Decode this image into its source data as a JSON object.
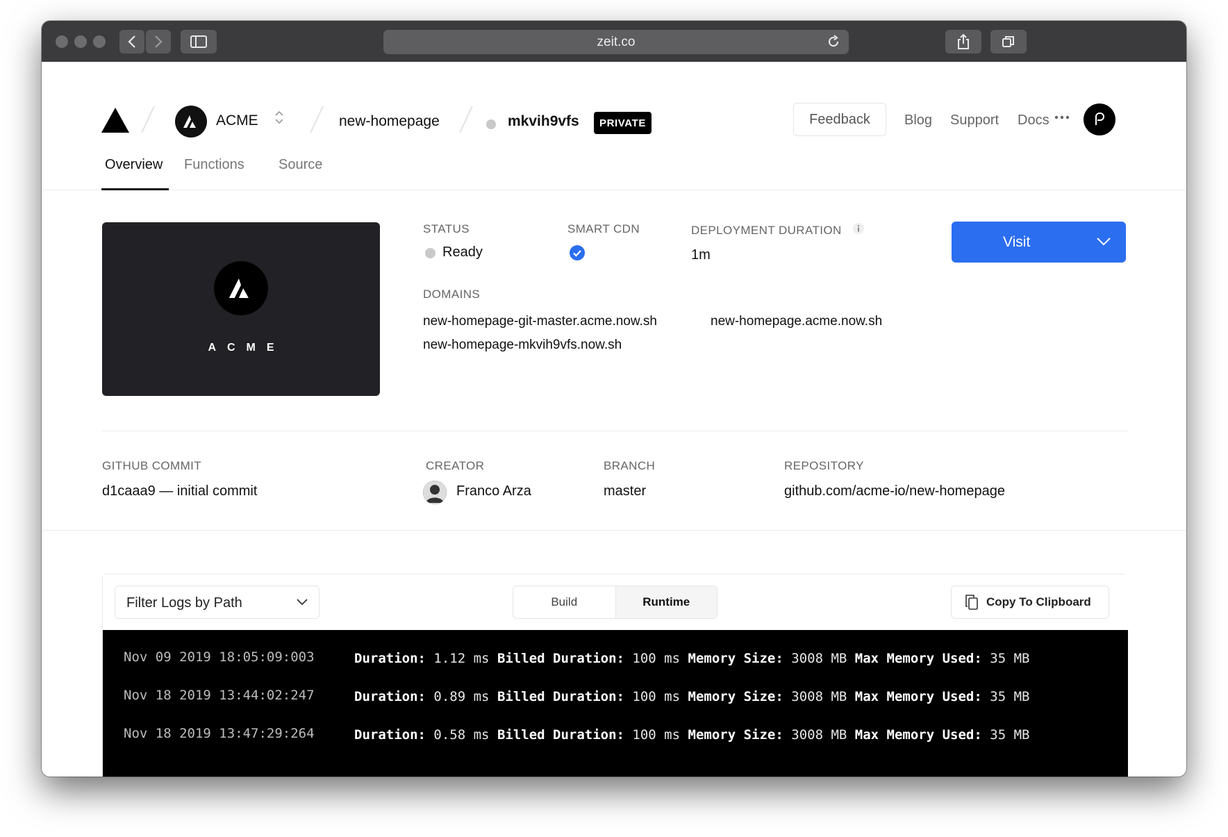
{
  "browser": {
    "url": "zeit.co"
  },
  "header": {
    "team": "ACME",
    "project": "new-homepage",
    "deployment_id": "mkvih9vfs",
    "badge": "PRIVATE",
    "feedback": "Feedback",
    "nav": [
      "Blog",
      "Support",
      "Docs"
    ]
  },
  "tabs": [
    "Overview",
    "Functions",
    "Source"
  ],
  "overview": {
    "preview_name": "ACME",
    "status_label": "STATUS",
    "status_value": "Ready",
    "cdn_label": "SMART CDN",
    "duration_label": "DEPLOYMENT DURATION",
    "duration_value": "1m",
    "domains_label": "DOMAINS",
    "domains": [
      "new-homepage-git-master.acme.now.sh",
      "new-homepage.acme.now.sh",
      "new-homepage-mkvih9vfs.now.sh"
    ],
    "visit": "Visit"
  },
  "meta": {
    "commit_label": "GITHUB COMMIT",
    "commit_value": "d1caaa9 — initial commit",
    "creator_label": "CREATOR",
    "creator_value": "Franco Arza",
    "branch_label": "BRANCH",
    "branch_value": "master",
    "repo_label": "REPOSITORY",
    "repo_value": "github.com/acme-io/new-homepage"
  },
  "logs": {
    "filter": "Filter Logs by Path",
    "segments": [
      "Build",
      "Runtime"
    ],
    "active_segment": "Runtime",
    "copy": "Copy To Clipboard",
    "lines": [
      {
        "ts": "Nov 09 2019 18:05:09:003",
        "duration": "1.12 ms",
        "billed": "100 ms",
        "memory": "3008 MB",
        "max_memory": "35 MB"
      },
      {
        "ts": "Nov 18 2019 13:44:02:247",
        "duration": "0.89 ms",
        "billed": "100 ms",
        "memory": "3008 MB",
        "max_memory": "35 MB"
      },
      {
        "ts": "Nov 18 2019 13:47:29:264",
        "duration": "0.58 ms",
        "billed": "100 ms",
        "memory": "3008 MB",
        "max_memory": "35 MB"
      }
    ]
  },
  "colors": {
    "accent": "#2b6ef0",
    "terminal_bg": "#000000",
    "chrome": "#3b3b3d"
  }
}
